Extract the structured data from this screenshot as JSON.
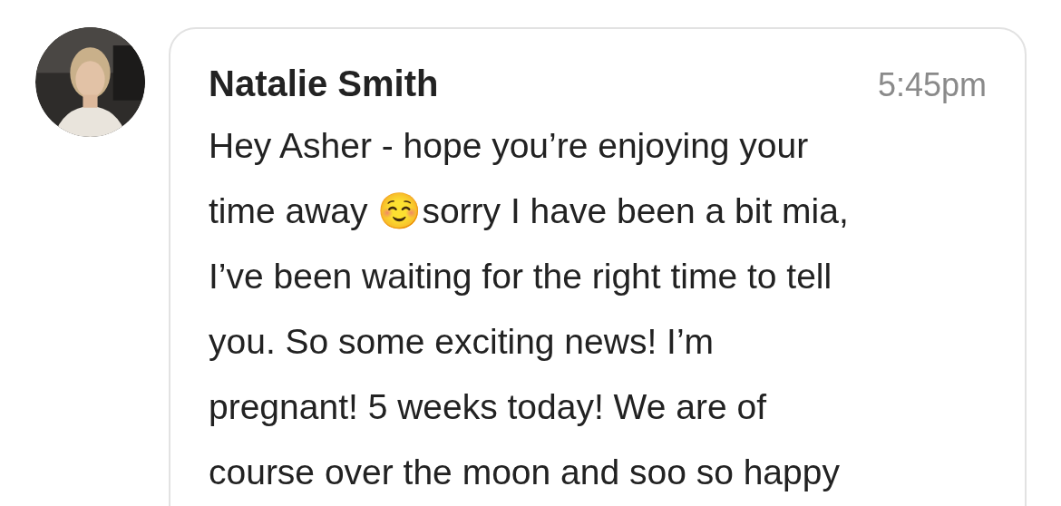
{
  "message": {
    "sender": "Natalie Smith",
    "time": "5:45pm",
    "lines": [
      "Hey Asher - hope you’re enjoying your",
      "time away ☺️sorry I have been a bit mia,",
      "I’ve been waiting for the right time to tell",
      "you. So some exciting news! I’m",
      "pregnant! 5 weeks today! We are of",
      "course over the moon and soo so happy"
    ]
  }
}
